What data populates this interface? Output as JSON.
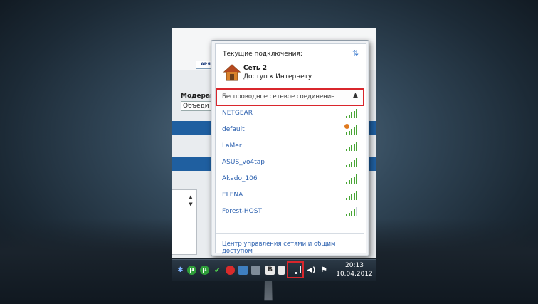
{
  "app": {
    "top_button": "АРЯ",
    "label": "Модерац",
    "select_value": "Объеди"
  },
  "popup": {
    "current_connections_label": "Текущие подключения:",
    "network_name": "Сеть  2",
    "network_status": "Доступ к Интернету",
    "section_title": "Беспроводное сетевое соединение",
    "wifi_networks": [
      {
        "name": "NETGEAR",
        "signal": 5,
        "secured": false
      },
      {
        "name": "default",
        "signal": 5,
        "secured": true
      },
      {
        "name": "LaMer",
        "signal": 5,
        "secured": false
      },
      {
        "name": "ASUS_vo4tap",
        "signal": 5,
        "secured": false
      },
      {
        "name": "Akado_106",
        "signal": 5,
        "secured": false
      },
      {
        "name": "ELENA",
        "signal": 5,
        "secured": false
      },
      {
        "name": "Forest-HOST",
        "signal": 4,
        "secured": false
      }
    ],
    "footer_link": "Центр управления сетями и общим доступом"
  },
  "taskbar": {
    "time": "20:13",
    "date": "10.04.2012",
    "tray_icons": [
      "bluetooth-icon",
      "utorrent-icon",
      "utorrent-alt-icon",
      "green-check-icon",
      "opera-icon",
      "lang-icon",
      "app-icon",
      "b-icon",
      "network-icon",
      "volume-icon",
      "flag-icon"
    ]
  },
  "colors": {
    "highlight": "#d9262c",
    "link": "#2a5fae",
    "signal": "#49a536"
  }
}
